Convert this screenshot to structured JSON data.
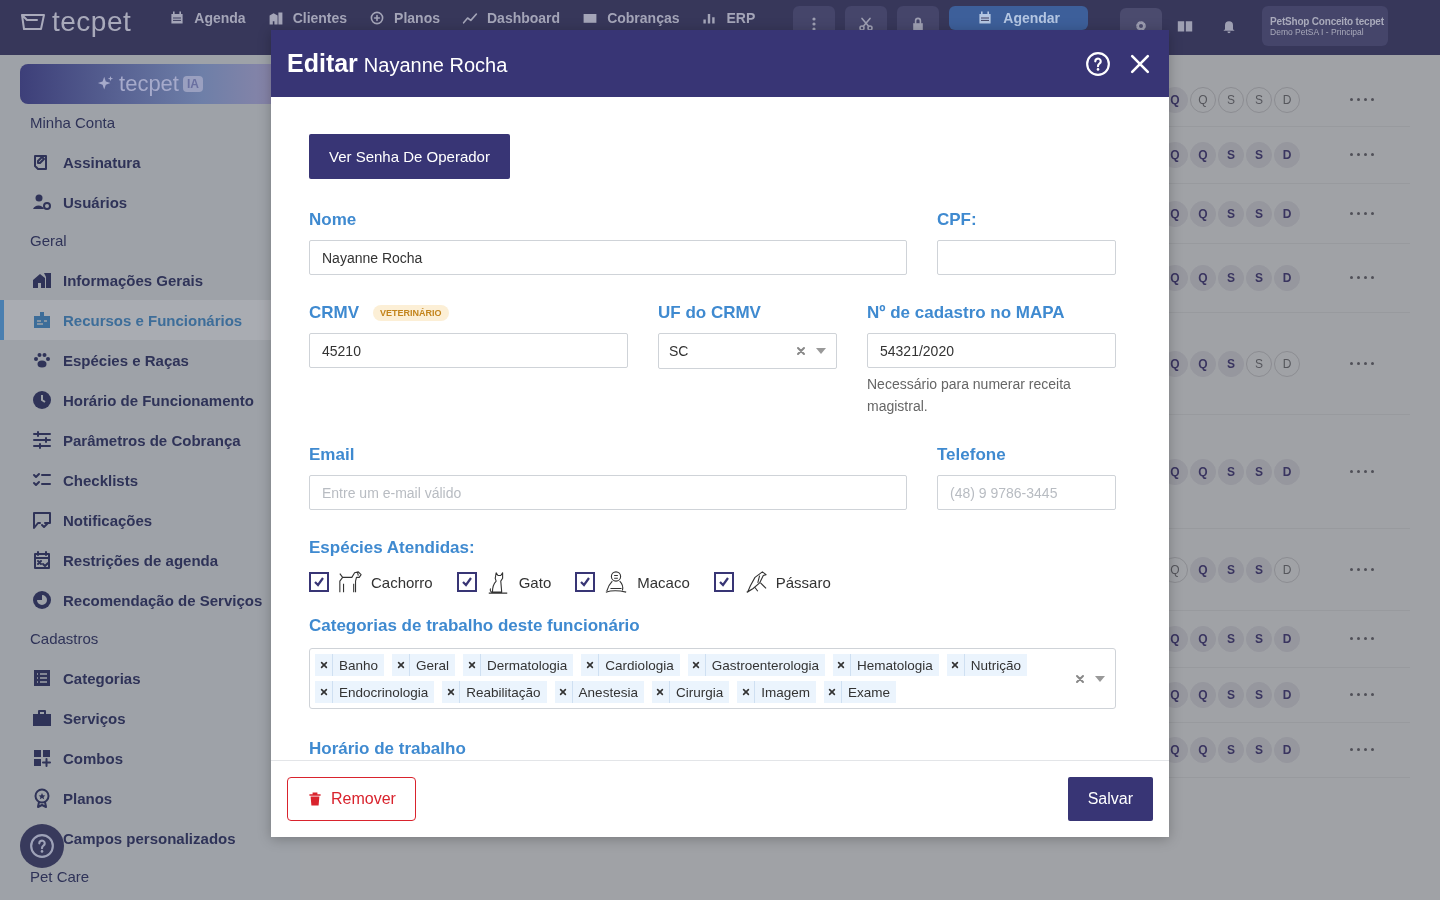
{
  "top_nav": {
    "logo": "tecpet",
    "items": [
      {
        "label": "Agenda"
      },
      {
        "label": "Clientes"
      },
      {
        "label": "Planos"
      },
      {
        "label": "Dashboard"
      },
      {
        "label": "Cobranças"
      },
      {
        "label": "ERP"
      }
    ],
    "schedule_button": "Agendar",
    "account": {
      "name": "PetShop Conceito tecpet",
      "unit": "Demo PetSA I - Principal"
    }
  },
  "sidebar": {
    "banner": {
      "logo": "tecpet",
      "badge": "IA"
    },
    "sections": [
      {
        "title": "Minha Conta",
        "items": [
          {
            "label": "Assinatura",
            "selected": false
          },
          {
            "label": "Usuários",
            "selected": false
          }
        ]
      },
      {
        "title": "Geral",
        "items": [
          {
            "label": "Informações Gerais",
            "selected": false
          },
          {
            "label": "Recursos e Funcionários",
            "selected": true
          },
          {
            "label": "Espécies e Raças",
            "selected": false
          },
          {
            "label": "Horário de Funcionamento",
            "selected": false
          },
          {
            "label": "Parâmetros de Cobrança",
            "selected": false
          },
          {
            "label": "Checklists",
            "selected": false
          },
          {
            "label": "Notificações",
            "selected": false
          },
          {
            "label": "Restrições de agenda",
            "selected": false
          },
          {
            "label": "Recomendação de Serviços",
            "selected": false
          }
        ]
      },
      {
        "title": "Cadastros",
        "items": [
          {
            "label": "Categorias",
            "selected": false
          },
          {
            "label": "Serviços",
            "selected": false
          },
          {
            "label": "Combos",
            "selected": false
          },
          {
            "label": "Planos",
            "selected": false
          },
          {
            "label": "Campos personalizados",
            "selected": false
          }
        ]
      },
      {
        "title": "Pet Care"
      }
    ]
  },
  "schedule_rows": [
    {
      "days": [
        {
          "label": "Q",
          "active": true
        },
        {
          "label": "Q",
          "active": false
        },
        {
          "label": "S",
          "active": false
        },
        {
          "label": "S",
          "active": false
        },
        {
          "label": "D",
          "active": false
        }
      ]
    },
    {
      "days": [
        {
          "label": "Q",
          "active": true
        },
        {
          "label": "Q",
          "active": true
        },
        {
          "label": "S",
          "active": true
        },
        {
          "label": "S",
          "active": true
        },
        {
          "label": "D",
          "active": true
        }
      ]
    },
    {
      "days": [
        {
          "label": "Q",
          "active": true
        },
        {
          "label": "Q",
          "active": true
        },
        {
          "label": "S",
          "active": true
        },
        {
          "label": "S",
          "active": true
        },
        {
          "label": "D",
          "active": true
        }
      ]
    },
    {
      "days": [
        {
          "label": "Q",
          "active": true
        },
        {
          "label": "Q",
          "active": true
        },
        {
          "label": "S",
          "active": true
        },
        {
          "label": "S",
          "active": true
        },
        {
          "label": "D",
          "active": true
        }
      ]
    },
    {
      "days": [
        {
          "label": "Q",
          "active": true
        },
        {
          "label": "Q",
          "active": true
        },
        {
          "label": "S",
          "active": true
        },
        {
          "label": "S",
          "active": false
        },
        {
          "label": "D",
          "active": false
        }
      ]
    },
    {
      "days": [
        {
          "label": "Q",
          "active": true
        },
        {
          "label": "Q",
          "active": true
        },
        {
          "label": "S",
          "active": true
        },
        {
          "label": "S",
          "active": true
        },
        {
          "label": "D",
          "active": true
        }
      ]
    },
    {
      "days": [
        {
          "label": "Q",
          "active": false
        },
        {
          "label": "Q",
          "active": true
        },
        {
          "label": "S",
          "active": true
        },
        {
          "label": "S",
          "active": true
        },
        {
          "label": "D",
          "active": false
        }
      ]
    },
    {
      "days": [
        {
          "label": "Q",
          "active": true
        },
        {
          "label": "Q",
          "active": true
        },
        {
          "label": "S",
          "active": true
        },
        {
          "label": "S",
          "active": true
        },
        {
          "label": "D",
          "active": true
        }
      ]
    },
    {
      "days": [
        {
          "label": "Q",
          "active": true
        },
        {
          "label": "Q",
          "active": true
        },
        {
          "label": "S",
          "active": true
        },
        {
          "label": "S",
          "active": true
        },
        {
          "label": "D",
          "active": true
        }
      ]
    },
    {
      "days": [
        {
          "label": "Q",
          "active": true
        },
        {
          "label": "Q",
          "active": true
        },
        {
          "label": "S",
          "active": true
        },
        {
          "label": "S",
          "active": true
        },
        {
          "label": "D",
          "active": true
        }
      ]
    }
  ],
  "modal": {
    "title": "Editar",
    "subtitle": "Nayanne Rocha",
    "operator_password_button": "Ver Senha De Operador",
    "name": {
      "label": "Nome",
      "value": "Nayanne Rocha"
    },
    "cpf": {
      "label": "CPF:"
    },
    "crmv": {
      "label": "CRMV",
      "badge": "VETERINÁRIO",
      "value": "45210"
    },
    "crmv_state": {
      "label": "UF do CRMV",
      "value": "SC"
    },
    "mapa": {
      "label": "Nº de cadastro no MAPA",
      "value": "54321/2020",
      "help": "Necessário para numerar receita magistral."
    },
    "email": {
      "label": "Email",
      "placeholder": "Entre um e-mail válido"
    },
    "phone": {
      "label": "Telefone",
      "placeholder": "(48) 9 9786-3445"
    },
    "species": {
      "label": "Espécies Atendidas:",
      "options": [
        {
          "label": "Cachorro",
          "checked": true
        },
        {
          "label": "Gato",
          "checked": true
        },
        {
          "label": "Macaco",
          "checked": true
        },
        {
          "label": "Pássaro",
          "checked": true
        }
      ]
    },
    "categories": {
      "label": "Categorias de trabalho deste funcionário",
      "tags": [
        "Banho",
        "Geral",
        "Dermatologia",
        "Cardiologia",
        "Gastroenterologia",
        "Hematologia",
        "Nutrição",
        "Endocrinologia",
        "Reabilitação",
        "Anestesia",
        "Cirurgia",
        "Imagem",
        "Exame"
      ]
    },
    "next_section": "Horário de trabalho",
    "remove_button": "Remover",
    "save_button": "Salvar"
  }
}
